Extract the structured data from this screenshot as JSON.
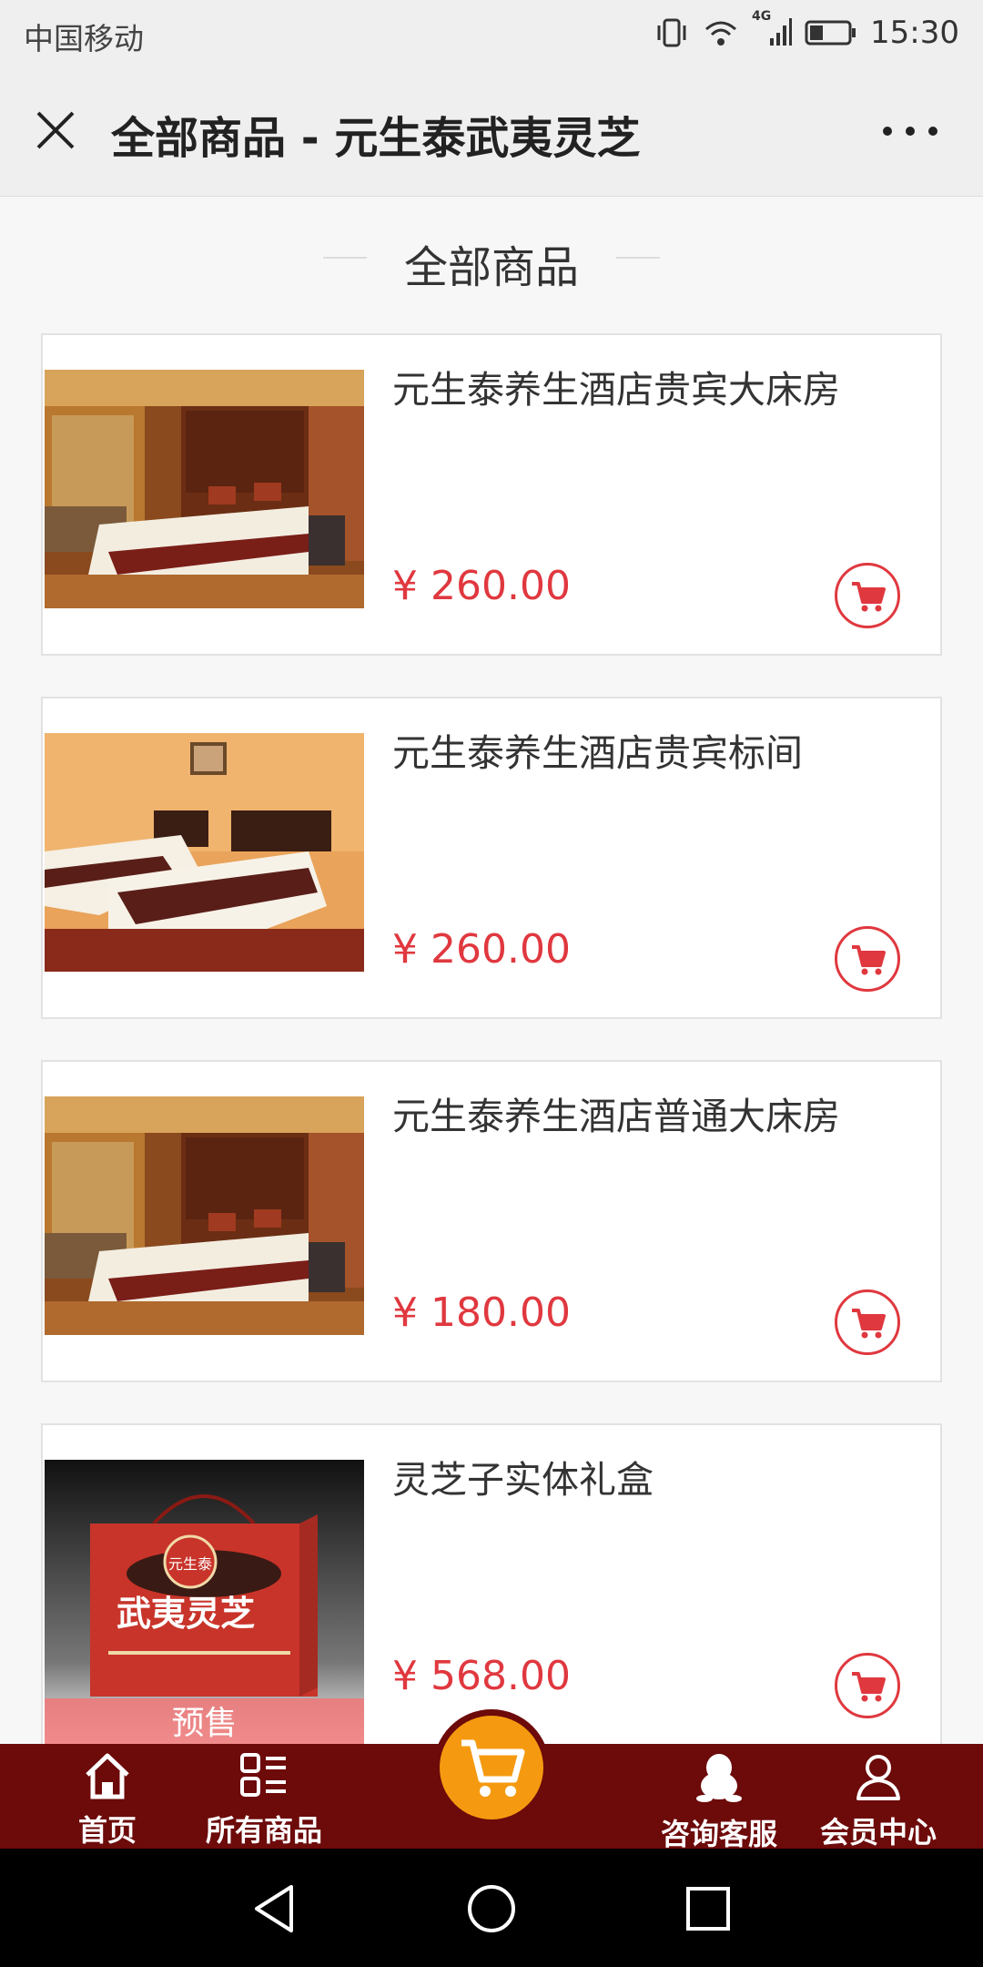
{
  "status_bar": {
    "carrier": "中国移动",
    "network": "4G",
    "time": "15:30"
  },
  "title_bar": {
    "title": "全部商品 - 元生泰武夷灵芝",
    "close_icon": "close-icon",
    "more_icon": "more-icon"
  },
  "section": {
    "title": "全部商品"
  },
  "products": [
    {
      "name": "元生泰养生酒店贵宾大床房",
      "price": "¥ 260.00",
      "image": "hotel-double-room"
    },
    {
      "name": "元生泰养生酒店贵宾标间",
      "price": "¥ 260.00",
      "image": "hotel-twin-room"
    },
    {
      "name": "元生泰养生酒店普通大床房",
      "price": "¥ 180.00",
      "image": "hotel-double-room"
    },
    {
      "name": "灵芝子实体礼盒",
      "price": "¥ 568.00",
      "image": "lingzhi-gift-box",
      "tag": "预售",
      "box_brand": "元生泰",
      "box_title": "武夷灵芝"
    }
  ],
  "bottom_nav": {
    "items": [
      {
        "label": "首页",
        "icon": "home-icon"
      },
      {
        "label": "所有商品",
        "icon": "grid-list-icon"
      },
      {
        "label": "",
        "icon": "cart-icon"
      },
      {
        "label": "咨询客服",
        "icon": "qq-penguin-icon"
      },
      {
        "label": "会员中心",
        "icon": "user-icon"
      }
    ]
  },
  "colors": {
    "accent_red": "#e0383f",
    "nav_bg": "#6d0a0a",
    "cart_orange": "#f59a10"
  }
}
